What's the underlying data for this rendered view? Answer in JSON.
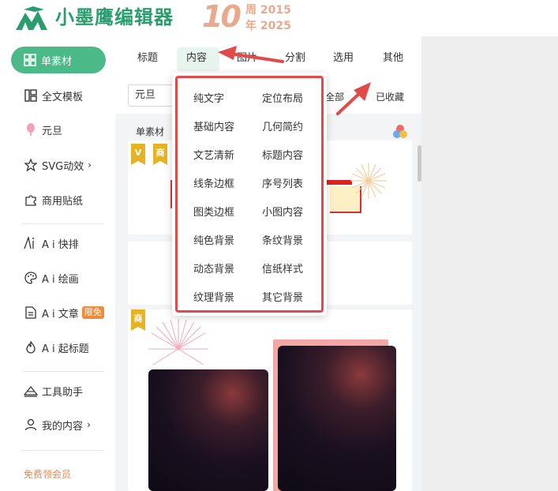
{
  "header": {
    "brand": "小墨鹰编辑器",
    "anniv_number": "10",
    "anniv_line1": "周 2015",
    "anniv_line2": "年 2025"
  },
  "sidebar": {
    "active": "单素材",
    "items": [
      {
        "label": "全文模板",
        "icon": "template-icon"
      },
      {
        "label": "元旦",
        "icon": "balloon-icon"
      },
      {
        "label": "SVG动效",
        "icon": "star-icon",
        "chevron": "›"
      },
      {
        "label": "商用贴纸",
        "icon": "puzzle-icon"
      },
      {
        "label": "A i 快排",
        "icon": "ai-icon"
      },
      {
        "label": "A i 绘画",
        "icon": "palette-icon"
      },
      {
        "label": "A i 文章",
        "icon": "document-icon",
        "badge": "限免"
      },
      {
        "label": "A i 起标题",
        "icon": "fire-icon"
      },
      {
        "label": "工具助手",
        "icon": "tools-icon"
      },
      {
        "label": "我的内容",
        "icon": "user-icon",
        "chevron": "›"
      }
    ],
    "vip_link": "免费领会员"
  },
  "tabs": [
    "标题",
    "内容",
    "图片",
    "分割",
    "选用",
    "其他"
  ],
  "filters": {
    "search_value": "元旦",
    "all": "全部",
    "favorites": "已收藏"
  },
  "section_title": "单素材",
  "tags": {
    "vip": "V",
    "commercial": "商"
  },
  "dropdown": {
    "left": [
      "纯文字",
      "基础内容",
      "文艺清新",
      "线条边框",
      "图类边框",
      "纯色背景",
      "动态背景",
      "纹理背景"
    ],
    "right": [
      "定位布局",
      "几何简约",
      "标题内容",
      "序号列表",
      "小图内容",
      "条纹背景",
      "信纸样式",
      "其它背景"
    ]
  },
  "colors": {
    "accent": "#4cb989",
    "brand": "#2a9d6f",
    "highlight": "#e24a4a",
    "anniversary": "#e9a98c"
  }
}
